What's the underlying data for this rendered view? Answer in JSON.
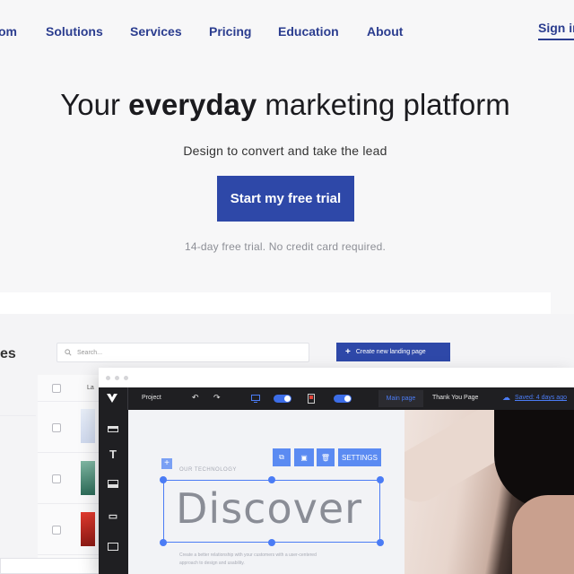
{
  "nav": {
    "links": [
      "om",
      "Solutions",
      "Services",
      "Pricing",
      "Education",
      "About"
    ],
    "sign_in": "Sign in"
  },
  "hero": {
    "title_pre": "Your ",
    "title_bold": "everyday",
    "title_post": " marketing platform",
    "subtitle": "Design to convert and take the lead",
    "cta": "Start my free trial",
    "note": "14-day free trial. No credit card required."
  },
  "dashboard": {
    "title_fragment": "es",
    "search_placeholder": "Search...",
    "create_button": "Create new landing page",
    "column_fragment": "La"
  },
  "editor": {
    "toolbar": {
      "project": "Project",
      "tab_main": "Main page",
      "tab_thank_you": "Thank You Page",
      "saved": "Saved: 4 days ago"
    },
    "element_toolbar": {
      "settings": "SETTINGS"
    },
    "canvas": {
      "eyebrow": "OUR TECHNOLOGY",
      "heading": "Discover",
      "body": "Create a better relationship with your customers with a user-centered approach to design and usability."
    }
  },
  "colors": {
    "brand": "#2e48a8",
    "nav_text": "#2b3d8f",
    "selection": "#4b7cf5",
    "toolbar_bg": "#1f1f22"
  }
}
